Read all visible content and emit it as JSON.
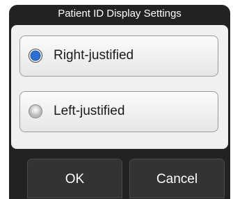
{
  "dialog": {
    "title": "Patient ID Display Settings",
    "options": [
      {
        "label": "Right-justified",
        "selected": true
      },
      {
        "label": "Left-justified",
        "selected": false
      }
    ],
    "buttons": {
      "ok": "OK",
      "cancel": "Cancel"
    }
  },
  "colors": {
    "accent": "#2d6fcf",
    "dialog_bg": "#222222",
    "panel_bg": "#f0f0f0"
  }
}
